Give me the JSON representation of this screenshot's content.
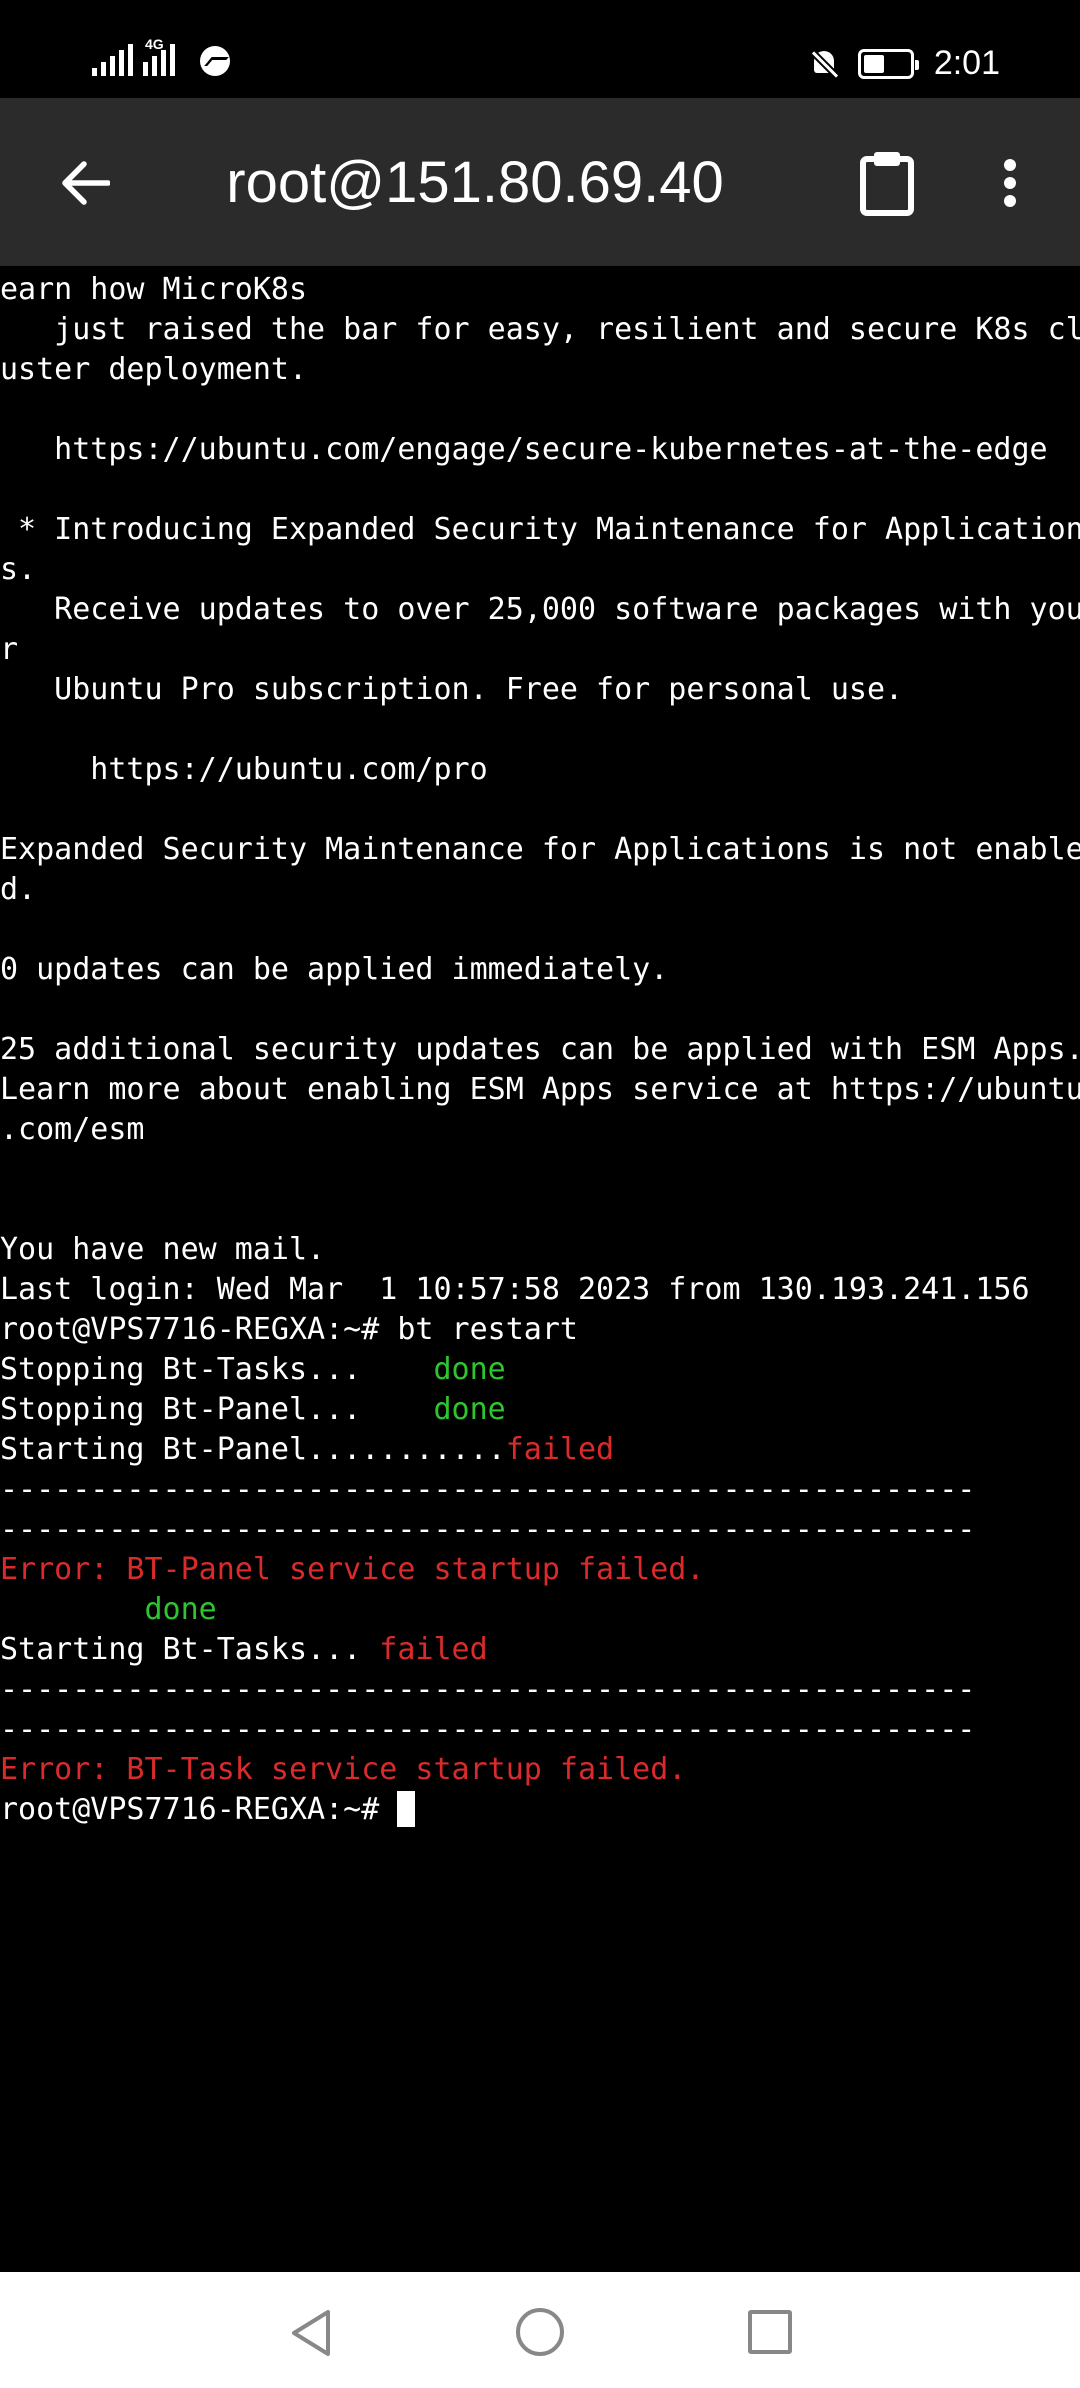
{
  "status_bar": {
    "network_label": "4G",
    "time": "2:01",
    "icons": [
      "signal-icon",
      "signal-4g-icon",
      "messenger-icon",
      "bell-off-icon",
      "battery-icon"
    ]
  },
  "app_bar": {
    "title": "root@151.80.69.40",
    "icons": [
      "back-arrow-icon",
      "clipboard-icon",
      "more-vert-icon"
    ]
  },
  "colors": {
    "terminal_bg": "#000000",
    "app_bar_bg": "#2b2b2b",
    "ok_green": "#2ec52e",
    "error_red": "#d92b2b"
  },
  "terminal": {
    "lines": [
      [
        {
          "t": "earn how MicroK8s"
        }
      ],
      [
        {
          "t": "   just raised the bar for easy, resilient and secure K8s cl"
        }
      ],
      [
        {
          "t": "uster deployment."
        }
      ],
      [
        {
          "t": ""
        }
      ],
      [
        {
          "t": "   https://ubuntu.com/engage/secure-kubernetes-at-the-edge"
        }
      ],
      [
        {
          "t": ""
        }
      ],
      [
        {
          "t": " * Introducing Expanded Security Maintenance for Application"
        }
      ],
      [
        {
          "t": "s."
        }
      ],
      [
        {
          "t": "   Receive updates to over 25,000 software packages with you"
        }
      ],
      [
        {
          "t": "r"
        }
      ],
      [
        {
          "t": "   Ubuntu Pro subscription. Free for personal use."
        }
      ],
      [
        {
          "t": ""
        }
      ],
      [
        {
          "t": "     https://ubuntu.com/pro"
        }
      ],
      [
        {
          "t": ""
        }
      ],
      [
        {
          "t": "Expanded Security Maintenance for Applications is not enable"
        }
      ],
      [
        {
          "t": "d."
        }
      ],
      [
        {
          "t": ""
        }
      ],
      [
        {
          "t": "0 updates can be applied immediately."
        }
      ],
      [
        {
          "t": ""
        }
      ],
      [
        {
          "t": "25 additional security updates can be applied with ESM Apps."
        }
      ],
      [
        {
          "t": "Learn more about enabling ESM Apps service at https://ubuntu"
        }
      ],
      [
        {
          "t": ".com/esm"
        }
      ],
      [
        {
          "t": ""
        }
      ],
      [
        {
          "t": ""
        }
      ],
      [
        {
          "t": "You have new mail."
        }
      ],
      [
        {
          "t": "Last login: Wed Mar  1 10:57:58 2023 from 130.193.241.156"
        }
      ],
      [
        {
          "t": "root@VPS7716-REGXA:~# bt restart"
        }
      ],
      [
        {
          "t": "Stopping Bt-Tasks...    "
        },
        {
          "t": "done",
          "c": "green"
        }
      ],
      [
        {
          "t": "Stopping Bt-Panel...    "
        },
        {
          "t": "done",
          "c": "green"
        }
      ],
      [
        {
          "t": "Starting Bt-Panel..........."
        },
        {
          "t": "failed",
          "c": "red"
        }
      ],
      [
        {
          "t": "------------------------------------------------------"
        }
      ],
      [
        {
          "t": "------------------------------------------------------"
        }
      ],
      [
        {
          "t": "Error: BT-Panel service startup failed.",
          "c": "red"
        }
      ],
      [
        {
          "t": "        "
        },
        {
          "t": "done",
          "c": "green"
        }
      ],
      [
        {
          "t": "Starting Bt-Tasks... "
        },
        {
          "t": "failed",
          "c": "red"
        }
      ],
      [
        {
          "t": "------------------------------------------------------"
        }
      ],
      [
        {
          "t": "------------------------------------------------------"
        }
      ],
      [
        {
          "t": "Error: BT-Task service startup failed.",
          "c": "red"
        }
      ],
      [
        {
          "t": "root@VPS7716-REGXA:~# "
        },
        {
          "cursor": true
        }
      ]
    ]
  },
  "nav_bar": {
    "icons": [
      "nav-back-icon",
      "nav-home-icon",
      "nav-recents-icon"
    ]
  }
}
